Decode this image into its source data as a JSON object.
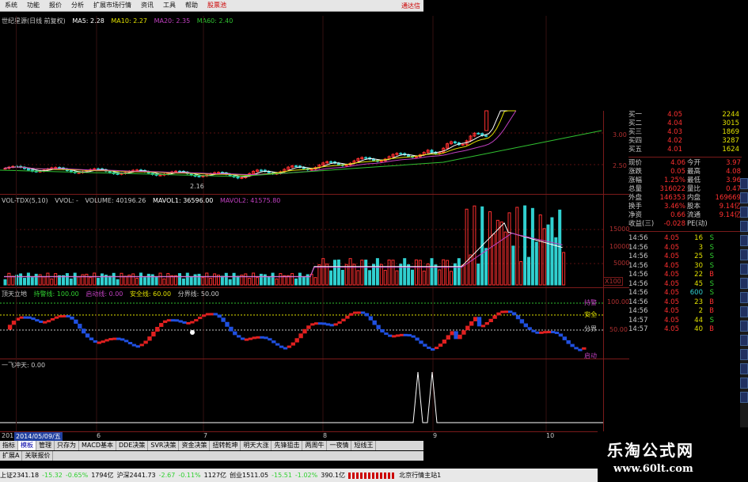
{
  "menu": {
    "items": [
      "系统",
      "功能",
      "报价",
      "分析",
      "扩展市场行情",
      "资讯",
      "工具",
      "帮助"
    ],
    "stock_tab": "股票池",
    "right_label": "通达信"
  },
  "main_chart": {
    "legend_title": "世纪星源(日线 前复权)",
    "ma5": "MA5: 2.28",
    "ma10": "MA10: 2.27",
    "ma20": "MA20: 2.35",
    "ma60": "MA60: 2.40",
    "y_labels": [
      "3.00",
      "2.50"
    ],
    "low_label": "2.16",
    "colors": {
      "ma5": "#ffffff",
      "ma10": "#e0e000",
      "ma20": "#c040c0",
      "ma60": "#30c030",
      "up": "#ff3030",
      "down": "#30d0d0"
    }
  },
  "volume_chart": {
    "name": "VOL-TDX(5,10)",
    "vvol": "VVOL: -",
    "volume": "VOLUME: 40196.26",
    "mavol1": "MAVOL1: 36596.00",
    "mavol2": "MAVOL2: 41575.80",
    "y_labels": [
      "15000",
      "10000",
      "5000"
    ],
    "unit": "X100"
  },
  "indicator1": {
    "name": "顶天立地",
    "l1": "持警线: 100.00",
    "l2": "启动线: 0.00",
    "l3": "安全线: 60.00",
    "l4": "分界线: 50.00",
    "right_tags": [
      "持警",
      "安全",
      "分界",
      "启动"
    ],
    "y_labels": [
      "100.00",
      "50.00"
    ]
  },
  "indicator2": {
    "name": "一飞冲天: 0.00"
  },
  "dates": {
    "first": "2014/05/09/五",
    "prefix": "201",
    "months": [
      "6",
      "7",
      "8",
      "9",
      "10"
    ]
  },
  "quote": {
    "buy": [
      {
        "label": "买一",
        "price": "4.05",
        "vol": "2244"
      },
      {
        "label": "买二",
        "price": "4.04",
        "vol": "3015"
      },
      {
        "label": "买三",
        "price": "4.03",
        "vol": "1869"
      },
      {
        "label": "买四",
        "price": "4.02",
        "vol": "3287"
      },
      {
        "label": "买五",
        "price": "4.01",
        "vol": "1624"
      }
    ],
    "stats": [
      {
        "l1": "现价",
        "v1": "4.06",
        "l2": "今开",
        "v2": "3.97"
      },
      {
        "l1": "涨跌",
        "v1": "0.05",
        "l2": "最高",
        "v2": "4.08"
      },
      {
        "l1": "涨幅",
        "v1": "1.25%",
        "l2": "最低",
        "v2": "3.96"
      },
      {
        "l1": "总量",
        "v1": "316022",
        "l2": "量比",
        "v2": "0.47"
      },
      {
        "l1": "外盘",
        "v1": "146353",
        "l2": "内盘",
        "v2": "169669"
      },
      {
        "l1": "换手",
        "v1": "3.46%",
        "l2": "股本",
        "v2": "9.14亿"
      },
      {
        "l1": "净资",
        "v1": "0.66",
        "l2": "流通",
        "v2": "9.14亿"
      },
      {
        "l1": "收益(三)",
        "v1": "-0.028",
        "l2": "PE(动)",
        "v2": ""
      }
    ],
    "ticks": [
      {
        "t": "14:56",
        "p": "4.05",
        "v": "16",
        "bs": "S"
      },
      {
        "t": "14:56",
        "p": "4.05",
        "v": "3",
        "bs": "S"
      },
      {
        "t": "14:56",
        "p": "4.05",
        "v": "25",
        "bs": "S"
      },
      {
        "t": "14:56",
        "p": "4.05",
        "v": "30",
        "bs": "S"
      },
      {
        "t": "14:56",
        "p": "4.05",
        "v": "22",
        "bs": "B"
      },
      {
        "t": "14:56",
        "p": "4.05",
        "v": "45",
        "bs": "S"
      },
      {
        "t": "14:56",
        "p": "4.05",
        "v": "600",
        "bs": "S"
      },
      {
        "t": "14:56",
        "p": "4.05",
        "v": "23",
        "bs": "B"
      },
      {
        "t": "14:56",
        "p": "4.05",
        "v": "2",
        "bs": "B"
      },
      {
        "t": "14:57",
        "p": "4.05",
        "v": "44",
        "bs": "S"
      },
      {
        "t": "14:57",
        "p": "4.05",
        "v": "40",
        "bs": "B"
      }
    ]
  },
  "tabs": [
    "指标",
    "模板",
    "管理",
    "只存为",
    "MACD基本",
    "DDE决策",
    "SVR决策",
    "资金决策",
    "扭转乾坤",
    "明天大涨",
    "先锋狙击",
    "两周牛",
    "一夜情",
    "短线王"
  ],
  "tabs2": [
    "扩展A",
    "关联报价"
  ],
  "status": {
    "sh": "上证2341.18",
    "sh_chg": "-15.32",
    "sh_pct": "-0.65%",
    "sh_amt": "1794亿",
    "hs": "沪深2441.73",
    "hs_chg": "-2.67",
    "hs_pct": "-0.11%",
    "hs_amt": "1127亿",
    "cy": "创业1511.05",
    "cy_chg": "-15.51",
    "cy_pct": "-1.02%",
    "cy_amt": "390.1亿",
    "server": "北京行情主站1"
  },
  "watermark": {
    "title": "乐淘公式网",
    "url": "www.60lt.com"
  }
}
